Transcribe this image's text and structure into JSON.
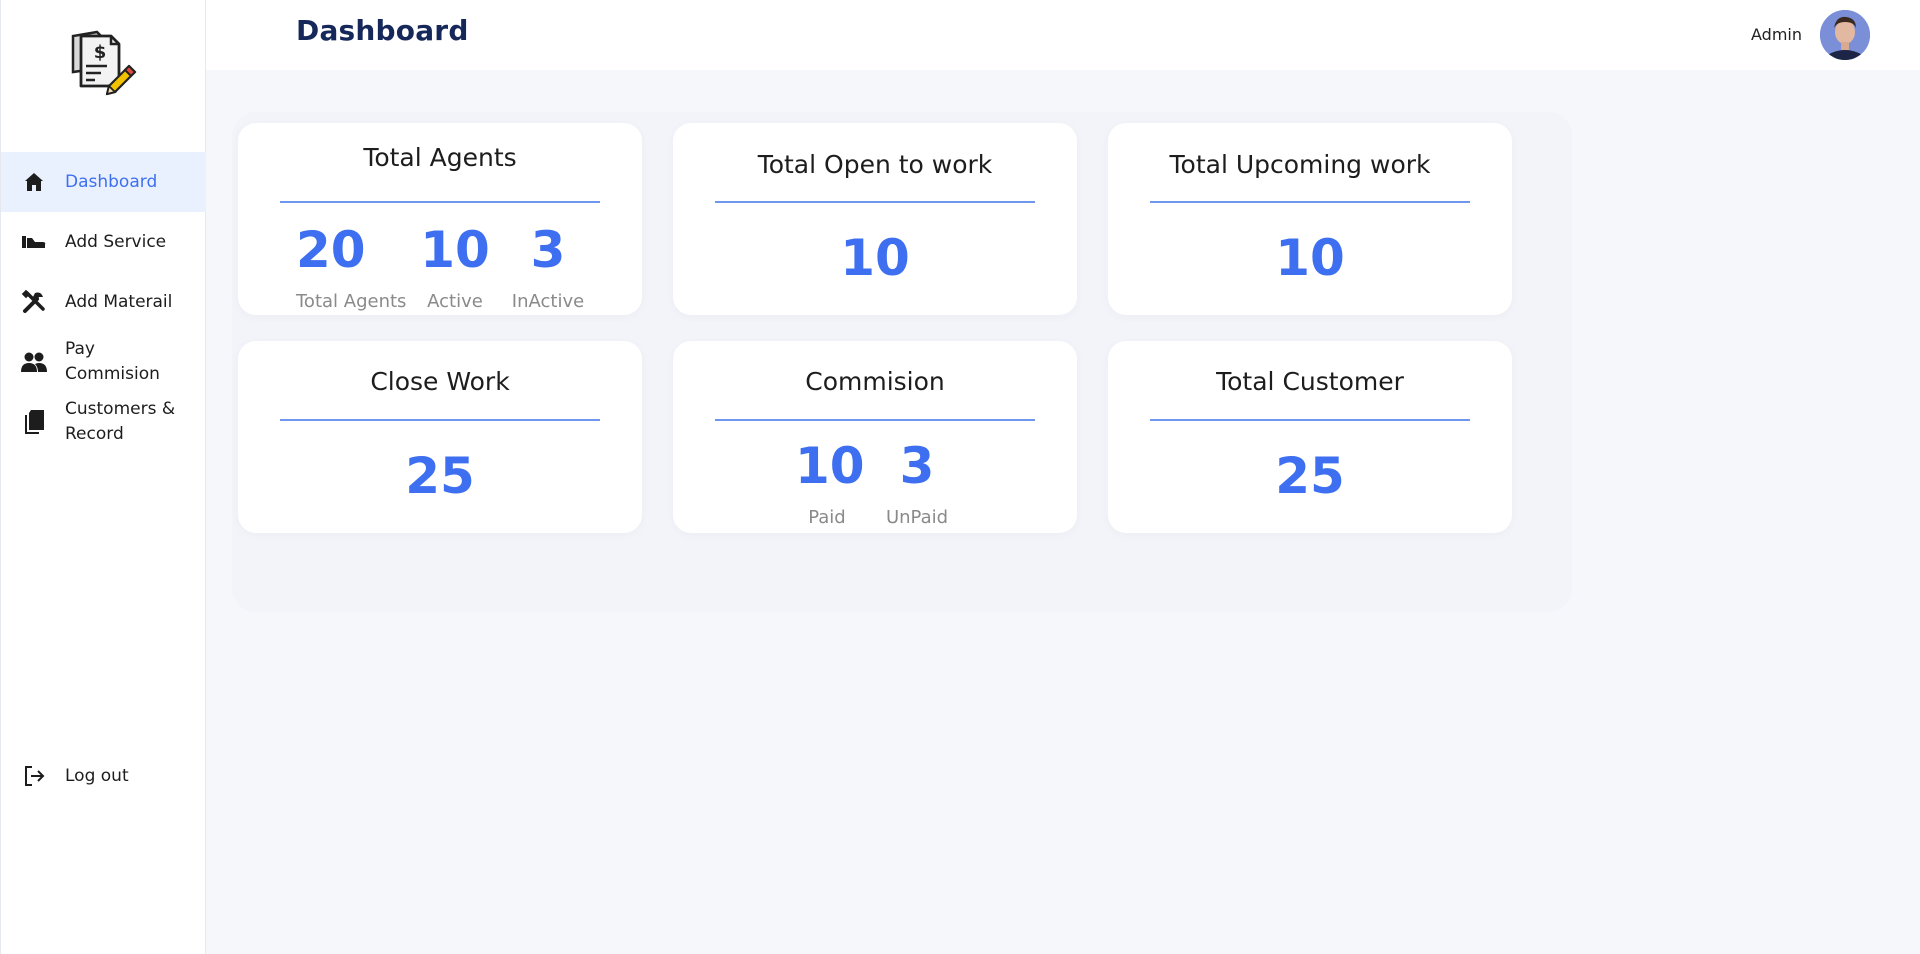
{
  "header": {
    "title": "Dashboard",
    "user_name": "Admin"
  },
  "sidebar": {
    "items": [
      {
        "label": "Dashboard",
        "icon": "home-icon",
        "active": true
      },
      {
        "label": "Add Service",
        "icon": "service-hand-icon"
      },
      {
        "label": "Add Materail",
        "icon": "tools-icon"
      },
      {
        "label": "Pay\nCommision",
        "icon": "people-icon"
      },
      {
        "label": "Customers &\nRecord",
        "icon": "documents-icon"
      }
    ],
    "logout": "Log out"
  },
  "cards": {
    "agents": {
      "title": "Total Agents",
      "total": "20",
      "total_label": "Total Agents",
      "active": "10",
      "active_label": "Active",
      "inactive": "3",
      "inactive_label": "InActive"
    },
    "open_work": {
      "title": "Total Open to work",
      "value": "10"
    },
    "upcoming_work": {
      "title": "Total Upcoming work",
      "value": "10"
    },
    "close_work": {
      "title": "Close Work",
      "value": "25"
    },
    "commission": {
      "title": "Commision",
      "paid": "10",
      "paid_label": "Paid",
      "unpaid": "3",
      "unpaid_label": "UnPaid"
    },
    "customers": {
      "title": "Total Customer",
      "value": "25"
    }
  },
  "colors": {
    "accent": "#3d6ff0",
    "title_dark": "#16275a",
    "active_bg": "#eaf1fe"
  }
}
